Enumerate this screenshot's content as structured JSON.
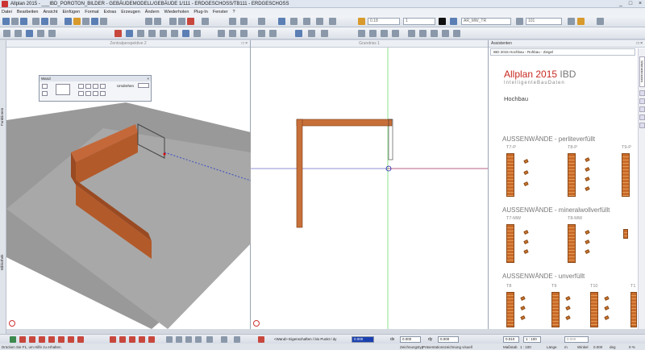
{
  "window": {
    "title": "Allplan 2015 - ___IBD_POROTON_BILDER - GEBÄUDEMODELL/GEBÄUDE 1/111 - ERDGESCHOSS/TB111 - ERDGESCHOSS",
    "controls": [
      "_",
      "□",
      "×"
    ]
  },
  "menu": [
    "Datei",
    "Bearbeiten",
    "Ansicht",
    "Einfügen",
    "Format",
    "Extras",
    "Erzeugen",
    "Ändern",
    "Wiederholen",
    "Plug-In",
    "Fenster",
    "?"
  ],
  "toolbar": {
    "pen_value": "0.18",
    "line_value": "1",
    "layer": "AR_MW_TR",
    "color_value": "101"
  },
  "left_strip": {
    "tab_top": "Funktionen",
    "tab_bottom": "Bibliothek"
  },
  "viewports": {
    "perspective": {
      "title": "Zentralperspektive 2"
    },
    "plan": {
      "title": "Grundriss 1"
    }
  },
  "wall_palette": {
    "title": "Wand",
    "option_label": "Umdrehen"
  },
  "assistant": {
    "header": "Assistenten",
    "path": "IBD 2015 Hochbau - Rohbau - Ziegel",
    "tab": "Wärmebrücken",
    "brand_main": "Allplan 2015",
    "brand_suffix": "IBD",
    "brand_sub": "IntelligenteBauDaten",
    "category": "Hochbau",
    "sections": [
      {
        "title": "AUSSENWÄNDE - perliteverfüllt",
        "blocks": [
          "T7-P",
          "T8-P",
          "T9-P"
        ]
      },
      {
        "title": "AUSSENWÄNDE - mineralwollverfüllt",
        "blocks": [
          "T7-MW",
          "T8-MW"
        ]
      },
      {
        "title": "AUSSENWÄNDE - unverfüllt",
        "blocks": [
          "T8",
          "T9",
          "T10",
          "T1"
        ]
      }
    ]
  },
  "input_line": {
    "prompt": "<Wand> Eigenschaften / bis Punkt / dy",
    "dy_value": "0.000",
    "dx_label": "dx",
    "dx_value": "0.000",
    "dy2_label": "dy",
    "dy2_value": "0.000",
    "angle_value": "0.000",
    "thickness": "0.010",
    "scale_value": "1 : 100"
  },
  "statusline": {
    "help": "Drücken Sie F1, um Hilfe zu erhalten.",
    "drawing_type_label": "Zeichnungstyp",
    "drawing_type_value": "Präsentationszeichnung visuell",
    "scale_label": "Maßstab",
    "scale_value": "1 : 100",
    "length_label": "Länge",
    "length_value": "m",
    "angle_label": "Winkel",
    "angle_value": "0.000",
    "unit_label": "deg",
    "percent": "0 %"
  }
}
